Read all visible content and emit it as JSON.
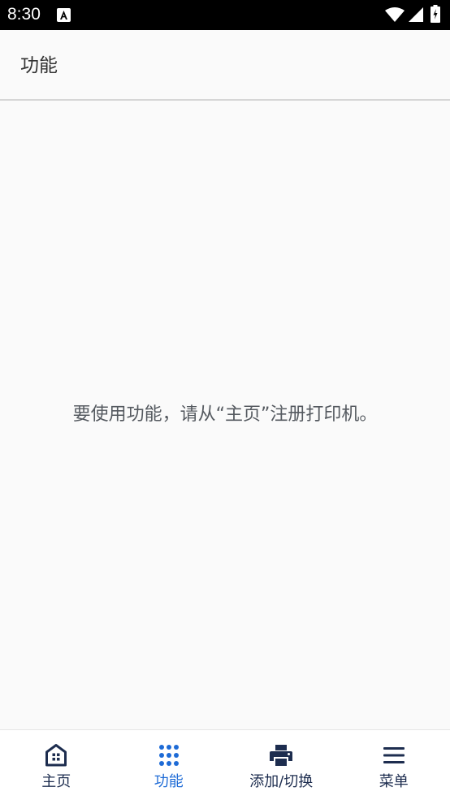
{
  "status_bar": {
    "time": "8:30",
    "icons": [
      "a-notification-icon",
      "wifi-icon",
      "signal-icon",
      "battery-icon"
    ]
  },
  "app_bar": {
    "title": "功能"
  },
  "main": {
    "empty_message": "要使用功能，请从“主页”注册打印机。"
  },
  "bottom_nav": {
    "items": [
      {
        "label": "主页",
        "icon": "home-icon",
        "active": false
      },
      {
        "label": "功能",
        "icon": "grid-dots-icon",
        "active": true
      },
      {
        "label": "添加/切换",
        "icon": "printer-icon",
        "active": false
      },
      {
        "label": "菜单",
        "icon": "menu-icon",
        "active": false
      }
    ]
  },
  "colors": {
    "status_bar_bg": "#000000",
    "background": "#fafafa",
    "nav_inactive": "#1d2d4f",
    "nav_active": "#1e6bd6",
    "message_text": "#555a60"
  }
}
